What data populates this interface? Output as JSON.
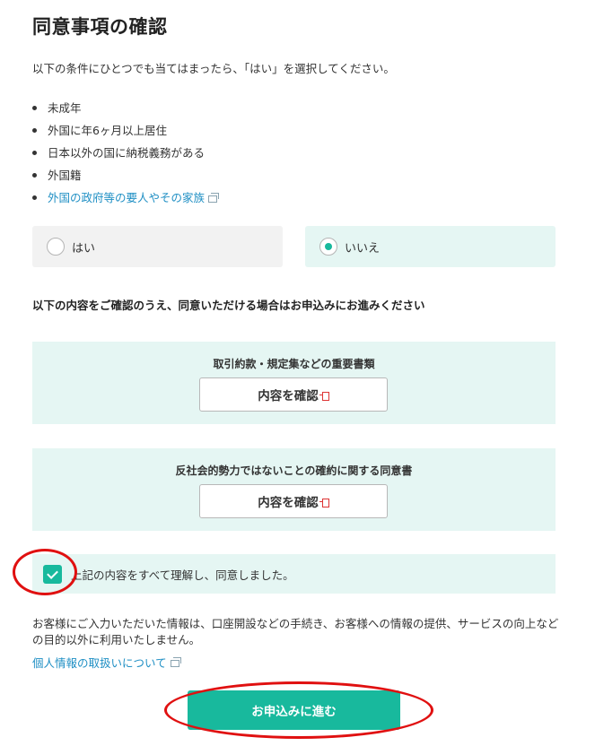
{
  "page": {
    "title": "同意事項の確認",
    "intro": "以下の条件にひとつでも当てはまったら、「はい」を選択してください。"
  },
  "conditions": [
    {
      "text": "未成年",
      "link": false
    },
    {
      "text": "外国に年6ヶ月以上居住",
      "link": false
    },
    {
      "text": "日本以外の国に納税義務がある",
      "link": false
    },
    {
      "text": "外国籍",
      "link": false
    },
    {
      "text": "外国の政府等の要人やその家族",
      "link": true,
      "icon": "external-link-icon"
    }
  ],
  "radio": {
    "yes_label": "はい",
    "no_label": "いいえ",
    "selected": "no"
  },
  "confirm": {
    "heading": "以下の内容をご確認のうえ、同意いただける場合はお申込みにお進みください",
    "documents": [
      {
        "title": "取引約款・規定集などの重要書類",
        "button_label": "内容を確認",
        "icon": "pdf-icon"
      },
      {
        "title": "反社会的勢力ではないことの確約に関する同意書",
        "button_label": "内容を確認",
        "icon": "pdf-icon"
      }
    ]
  },
  "agreement": {
    "label": "上記の内容をすべて理解し、同意しました。",
    "checked": true
  },
  "privacy": {
    "note": "お客様にご入力いただいた情報は、口座開設などの手続き、お客様への情報の提供、サービスの向上などの目的以外に利用いたしません。",
    "link_label": "個人情報の取扱いについて"
  },
  "submit": {
    "label": "お申込みに進む"
  },
  "colors": {
    "accent": "#18b99d",
    "panel_bg": "#e5f6f3",
    "link": "#1f8fc4",
    "annotation": "#e01010"
  }
}
